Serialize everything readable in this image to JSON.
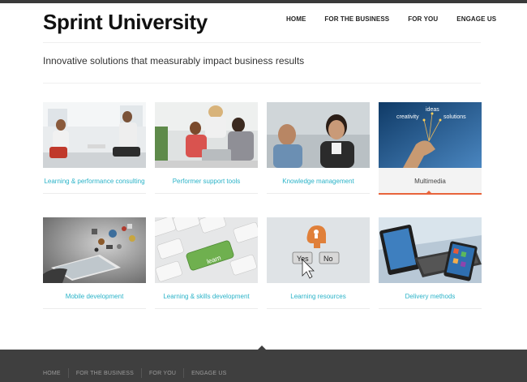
{
  "site": {
    "title": "Sprint University",
    "tagline": "Innovative solutions that measurably impact business results"
  },
  "nav": {
    "items": [
      "HOME",
      "FOR THE BUSINESS",
      "FOR YOU",
      "ENGAGE US"
    ]
  },
  "tiles": [
    {
      "label": "Learning & performance consulting",
      "image": "meeting-photo"
    },
    {
      "label": "Performer support tools",
      "image": "team-laptop-photo"
    },
    {
      "label": "Knowledge management",
      "image": "smiling-colleagues-photo"
    },
    {
      "label": "Multimedia",
      "image": "hand-ideas-photo",
      "active": true,
      "image_words": [
        "ideas",
        "creativity",
        "solutions"
      ]
    },
    {
      "label": "Mobile development",
      "image": "tablet-objects-photo"
    },
    {
      "label": "Learning & skills development",
      "image": "keyboard-learn-photo",
      "image_key_text": "learn"
    },
    {
      "label": "Learning resources",
      "image": "yes-no-buttons-photo",
      "image_buttons": [
        "Yes",
        "No"
      ]
    },
    {
      "label": "Delivery methods",
      "image": "devices-photo"
    }
  ],
  "footer": {
    "items": [
      "HOME",
      "FOR THE BUSINESS",
      "FOR YOU",
      "ENGAGE US"
    ]
  },
  "colors": {
    "accent": "#2bb3c8",
    "active": "#e8643c",
    "footer": "#3f3f3f"
  }
}
